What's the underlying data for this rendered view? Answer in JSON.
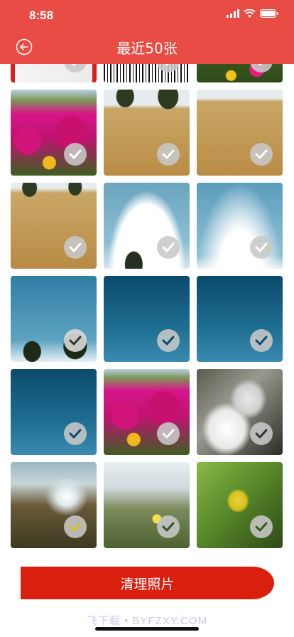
{
  "status_bar": {
    "time": "8:58"
  },
  "header": {
    "title": "最近50张"
  },
  "icons": {
    "back": "back-arrow-icon",
    "check": "checkmark-icon"
  },
  "actions": {
    "clean_label": "清理照片"
  },
  "watermark": "飞下载 • BYFZXY.COM",
  "colors": {
    "header": "#e94b45",
    "button": "#da1f0e"
  }
}
